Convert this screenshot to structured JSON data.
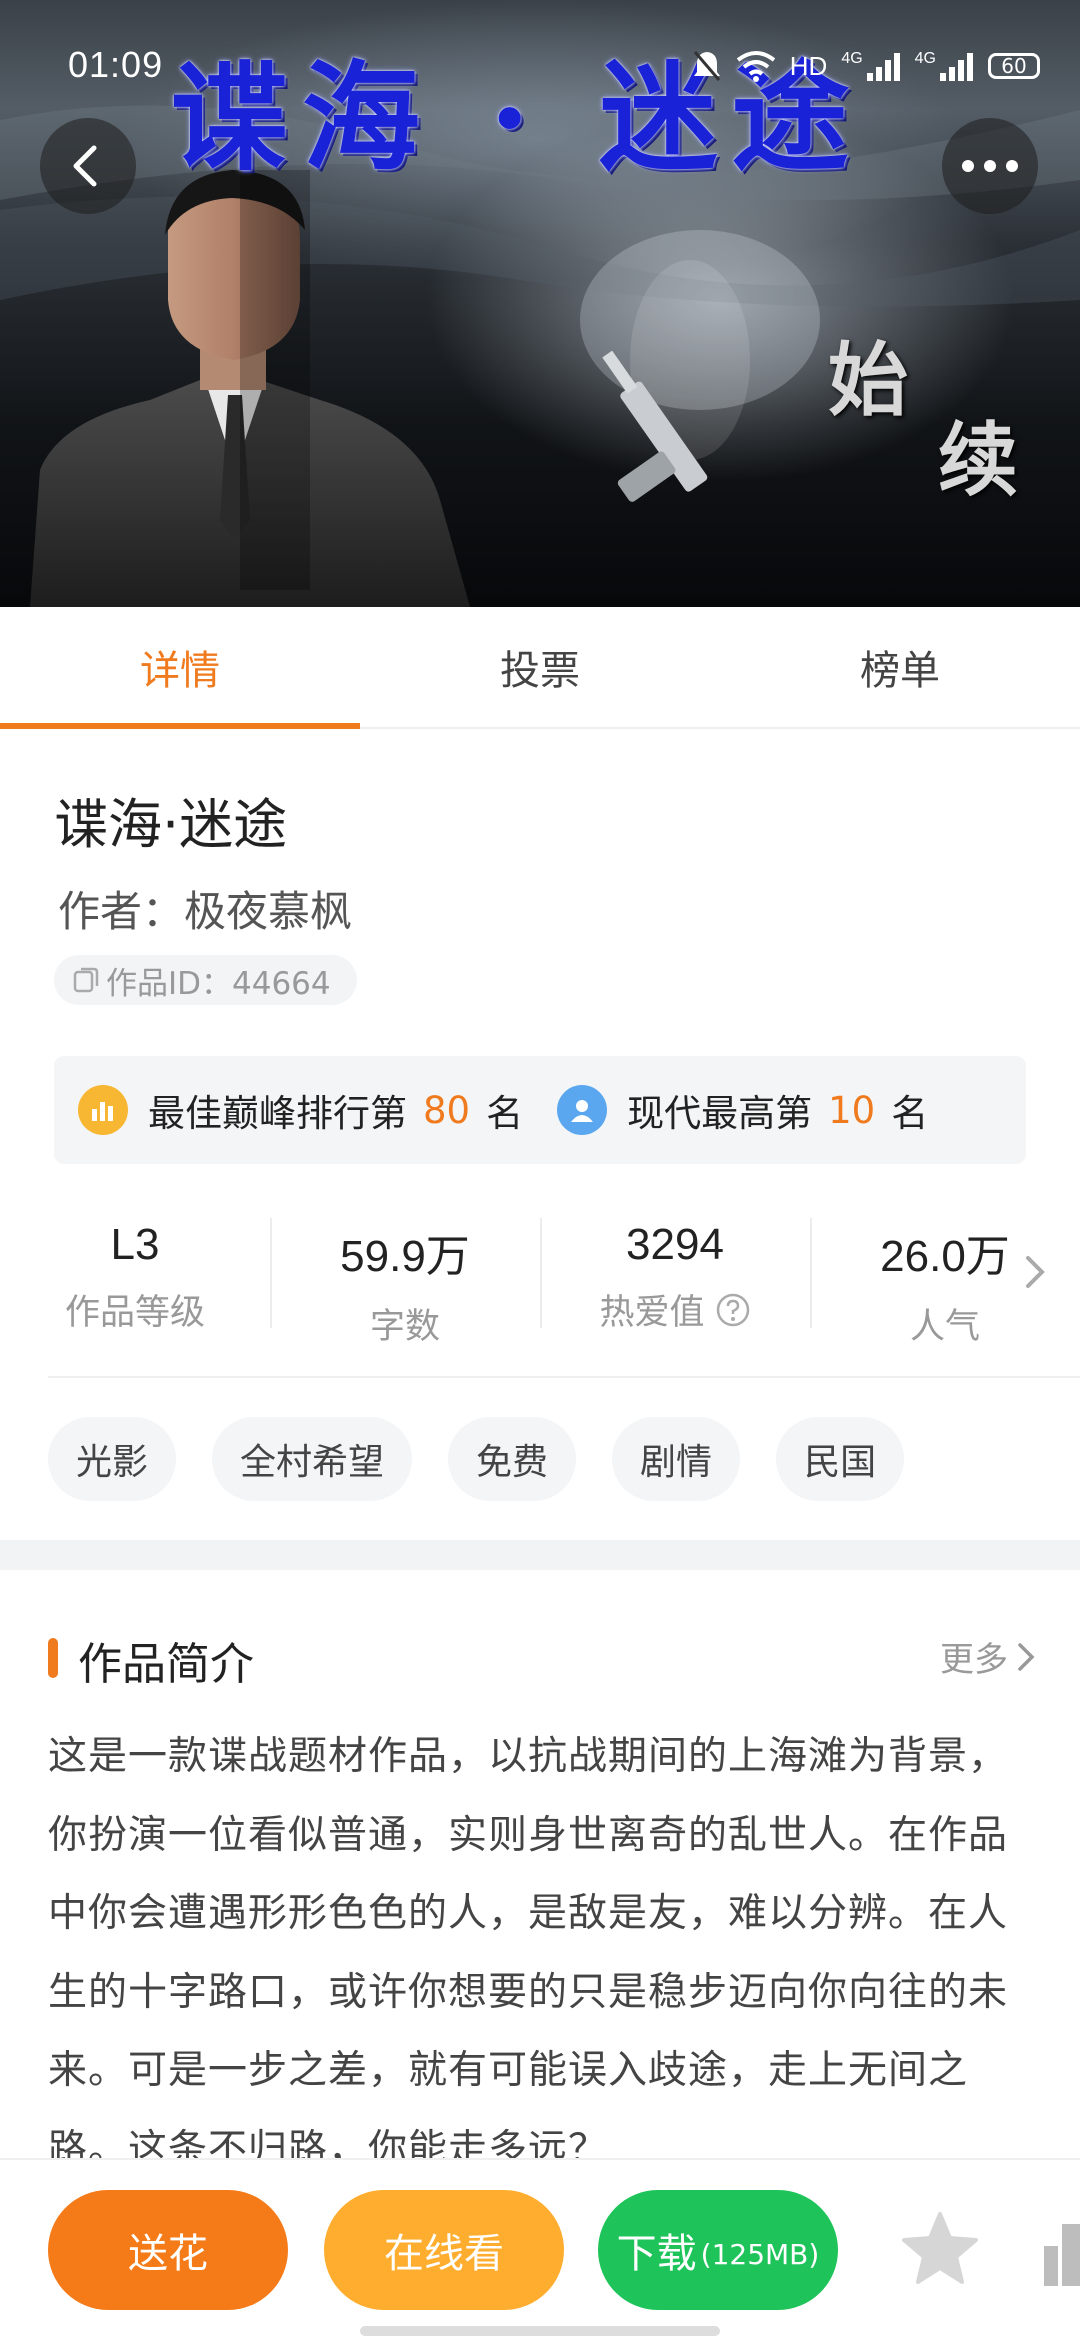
{
  "status_bar": {
    "time": "01:09",
    "network_label": "HD",
    "net_4g_a": "4G",
    "net_4g_b": "4G",
    "battery": "60"
  },
  "hero": {
    "title_art": "谍海 · 迷途",
    "side_text_1": "始",
    "side_text_2": "续"
  },
  "tabs": [
    {
      "label": "详情",
      "active": true
    },
    {
      "label": "投票",
      "active": false
    },
    {
      "label": "榜单",
      "active": false
    }
  ],
  "work": {
    "title": "谍海·迷途",
    "author": "作者：极夜慕枫",
    "id_label": "作品ID：44664"
  },
  "ranks": [
    {
      "prefix": "最佳巅峰排行第",
      "number": "80",
      "suffix": "名",
      "icon": "bar-chart-icon",
      "color": "#f7b733"
    },
    {
      "prefix": "现代最高第",
      "number": "10",
      "suffix": "名",
      "icon": "user-badge-icon",
      "color": "#5aa7f0"
    }
  ],
  "stats": [
    {
      "value": "L3",
      "label": "作品等级"
    },
    {
      "value": "59.9万",
      "label": "字数"
    },
    {
      "value": "3294",
      "label": "热爱值"
    },
    {
      "value": "26.0万",
      "label": "人气"
    }
  ],
  "tags": [
    "光影",
    "全村希望",
    "免费",
    "剧情",
    "民国"
  ],
  "intro": {
    "title": "作品简介",
    "more": "更多",
    "text": "这是一款谍战题材作品，以抗战期间的上海滩为背景，你扮演一位看似普通，实则身世离奇的乱世人。在作品中你会遭遇形形色色的人，是敌是友，难以分辨。在人生的十字路口，或许你想要的只是稳步迈向你向往的未来。可是一步之差，就有可能误入歧途，走上无间之路。这条不归路，你能走多远？"
  },
  "bottom": {
    "flower": "送花",
    "online": "在线看",
    "download": "下载",
    "download_size": "(125MB)"
  },
  "colors": {
    "accent": "#f07a1e",
    "flower_button": "#f57a18",
    "online_button": "#ffad2e",
    "download_button": "#1ec45a"
  }
}
